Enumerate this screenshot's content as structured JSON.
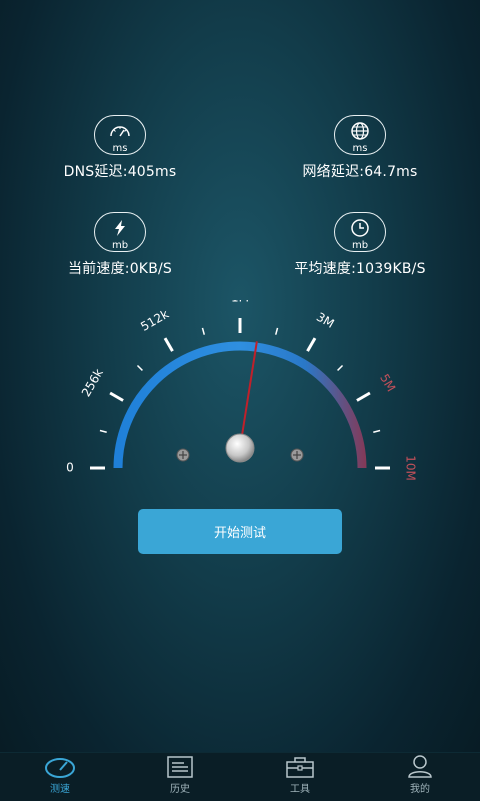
{
  "stats": {
    "dns": {
      "unit": "ms",
      "text": "DNS延迟:405ms",
      "icon": "speedometer-icon"
    },
    "latency": {
      "unit": "ms",
      "text": "网络延迟:64.7ms",
      "icon": "globe-icon"
    },
    "current_speed": {
      "unit": "mb",
      "text": "当前速度:0KB/S",
      "icon": "lightning-icon"
    },
    "average_speed": {
      "unit": "mb",
      "text": "平均速度:1039KB/S",
      "icon": "clock-icon"
    }
  },
  "gauge": {
    "labels": [
      "0",
      "256k",
      "512k",
      "1M",
      "3M",
      "5M",
      "10M"
    ],
    "needle_scale_position": 0.55
  },
  "start_button": {
    "label": "开始测试"
  },
  "tabs": [
    {
      "label": "测速",
      "icon": "speedometer-icon",
      "active": true
    },
    {
      "label": "历史",
      "icon": "document-icon",
      "active": false
    },
    {
      "label": "工具",
      "icon": "toolbox-icon",
      "active": false
    },
    {
      "label": "我的",
      "icon": "user-icon",
      "active": false
    }
  ],
  "colors": {
    "accent": "#3aa6d6",
    "arc_start": "#1e7fd8",
    "arc_end": "#8a3550",
    "needle": "#c0202a"
  }
}
